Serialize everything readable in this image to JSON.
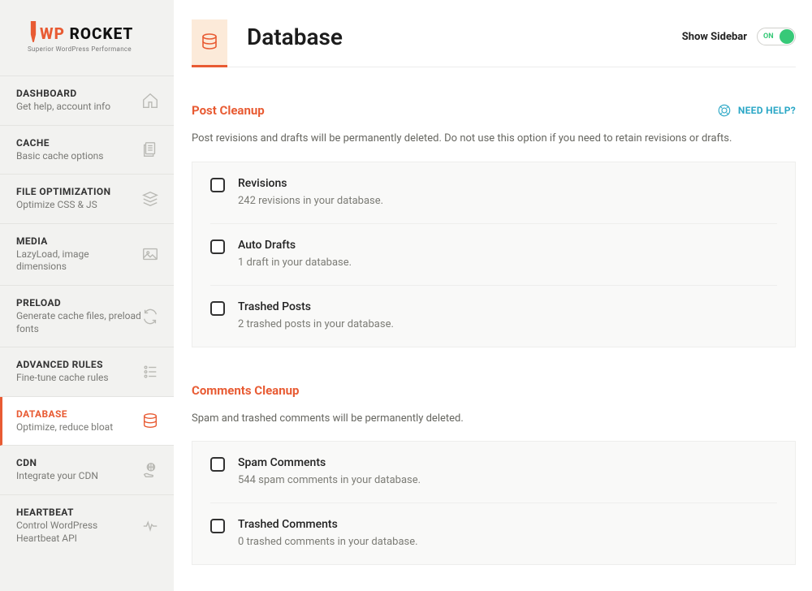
{
  "logo": {
    "brand1": "WP",
    "brand2": " ROCKET",
    "tag": "Superior WordPress Performance"
  },
  "nav": [
    {
      "title": "DASHBOARD",
      "desc": "Get help, account info"
    },
    {
      "title": "CACHE",
      "desc": "Basic cache options"
    },
    {
      "title": "FILE OPTIMIZATION",
      "desc": "Optimize CSS & JS"
    },
    {
      "title": "MEDIA",
      "desc": "LazyLoad, image dimensions"
    },
    {
      "title": "PRELOAD",
      "desc": "Generate cache files, preload fonts"
    },
    {
      "title": "ADVANCED RULES",
      "desc": "Fine-tune cache rules"
    },
    {
      "title": "DATABASE",
      "desc": "Optimize, reduce bloat"
    },
    {
      "title": "CDN",
      "desc": "Integrate your CDN"
    },
    {
      "title": "HEARTBEAT",
      "desc": "Control WordPress Heartbeat API"
    }
  ],
  "header": {
    "title": "Database",
    "show_sidebar": "Show Sidebar",
    "toggle_text": "ON"
  },
  "need_help": "NEED HELP?",
  "sections": [
    {
      "title": "Post Cleanup",
      "desc": "Post revisions and drafts will be permanently deleted. Do not use this option if you need to retain revisions or drafts.",
      "items": [
        {
          "title": "Revisions",
          "desc": "242 revisions in your database."
        },
        {
          "title": "Auto Drafts",
          "desc": "1 draft in your database."
        },
        {
          "title": "Trashed Posts",
          "desc": "2 trashed posts in your database."
        }
      ]
    },
    {
      "title": "Comments Cleanup",
      "desc": "Spam and trashed comments will be permanently deleted.",
      "items": [
        {
          "title": "Spam Comments",
          "desc": "544 spam comments in your database."
        },
        {
          "title": "Trashed Comments",
          "desc": "0 trashed comments in your database."
        }
      ]
    }
  ]
}
